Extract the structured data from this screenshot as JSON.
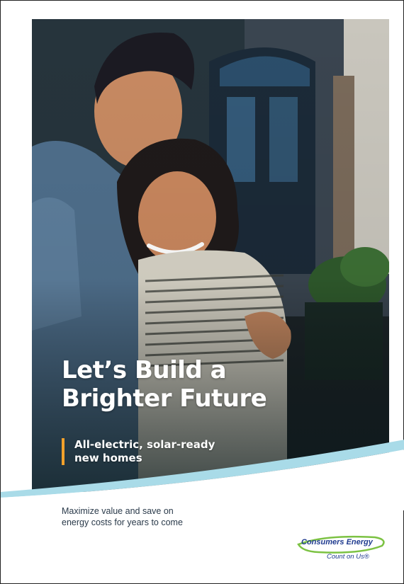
{
  "cover": {
    "headline_line1": "Let’s Build a",
    "headline_line2": "Brighter Future",
    "subhead_line1": "All-electric, solar-ready",
    "subhead_line2": "new homes",
    "tagline_line1": "Maximize value and save on",
    "tagline_line2": "energy costs for years to come"
  },
  "logo": {
    "brand": "Consumers Energy",
    "slogan": "Count on Us®"
  },
  "colors": {
    "accent_bar": "#f2a12b",
    "wave_blue": "#a9dbe8",
    "brand_navy": "#1f3b8f",
    "logo_green": "#7cc243"
  }
}
